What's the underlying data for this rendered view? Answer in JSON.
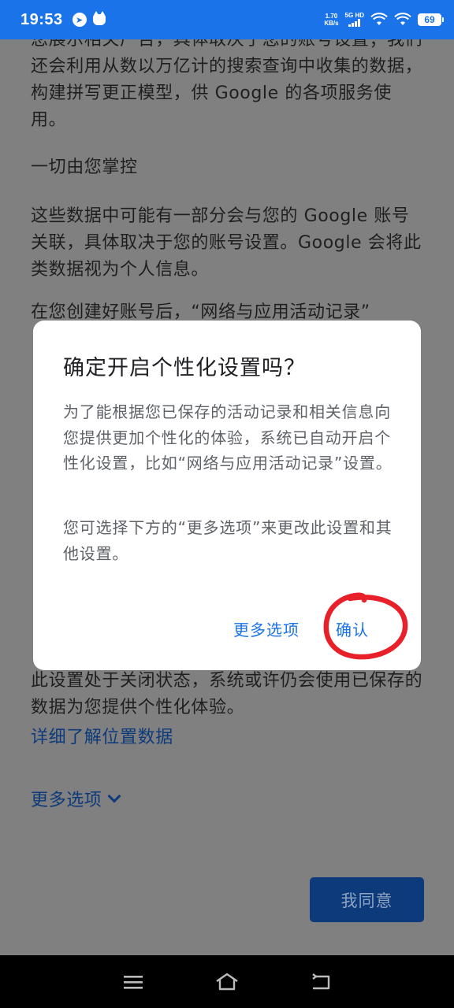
{
  "status_bar": {
    "time": "19:53",
    "net_speed_value": "1.70",
    "net_speed_unit": "KB/s",
    "signal_label": "5G HD",
    "battery": "69",
    "icons": [
      "telegram-icon",
      "cat-icon",
      "signal-icon",
      "wifi-icon",
      "battery-icon"
    ]
  },
  "page": {
    "paragraphs": [
      "您展示相关广告，具体取决于您的账号设置；我们还会利用从数以万亿计的搜索查询中收集的数据，构建拼写更正模型，供 Google 的各项服务使用。",
      "一切由您掌控",
      "这些数据中可能有一部分会与您的 Google 账号关联，具体取决于您的账号设置。Google 会将此类数据视为个人信息。",
      "在您创建好账号后，“网络与应用活动记录”",
      "此设置处于关闭状态，系统或许仍会使用已保存的数据为您提供个性化体验。"
    ],
    "learn_location_link": "详细了解位置数据",
    "more_options_link": "更多选项",
    "agree_button": "我同意"
  },
  "dialog": {
    "title": "确定开启个性化设置吗？",
    "body_1": "为了能根据您已保存的活动记录和相关信息向您提供更加个性化的体验，系统已自动开启个性化设置，比如“网络与应用活动记录”设置。",
    "body_2": "您可选择下方的“更多选项”来更改此设置和其他设置。",
    "more_options_button": "更多选项",
    "confirm_button": "确认"
  },
  "annotation": {
    "color": "#e8202a"
  },
  "colors": {
    "status_bar": "#1a73e8",
    "link": "#1a73e8",
    "agree_button": "#1a73e8",
    "dim_overlay_bg": "#808080"
  },
  "nav_bar": {
    "icons": [
      "menu-icon",
      "home-icon",
      "back-icon"
    ]
  }
}
